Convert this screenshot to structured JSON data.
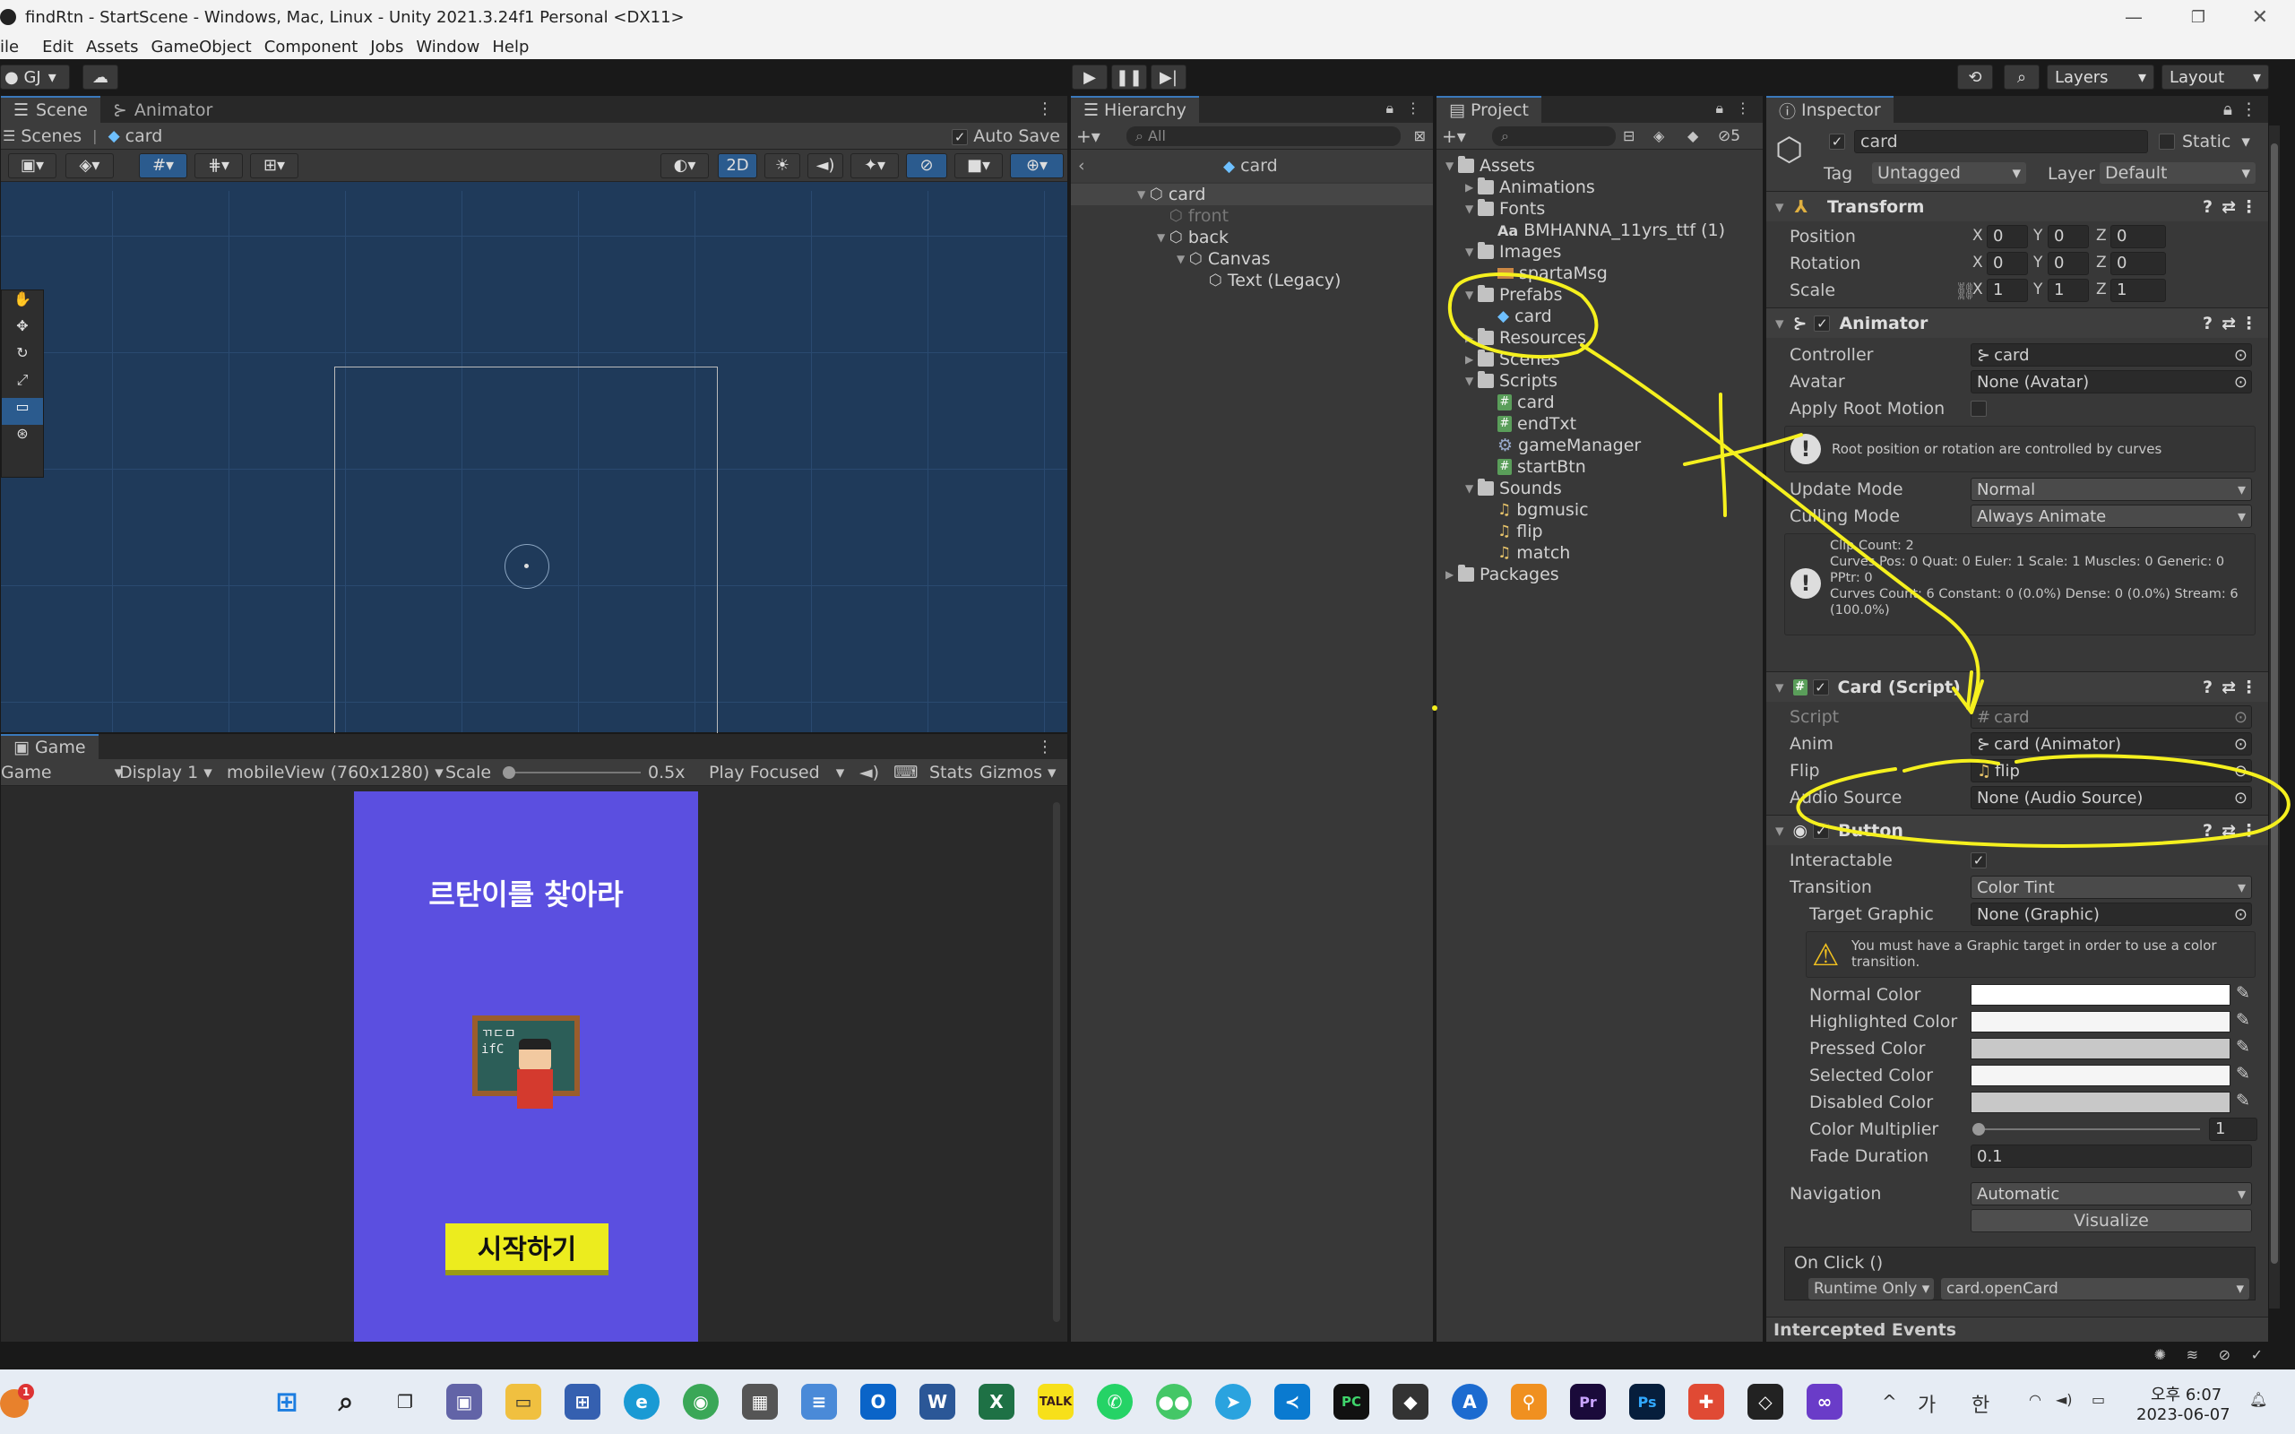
{
  "window": {
    "title": "findRtn - StartScene - Windows, Mac, Linux - Unity 2021.3.24f1 Personal <DX11>"
  },
  "menu": [
    "File",
    "Edit",
    "Assets",
    "GameObject",
    "Component",
    "Jobs",
    "Window",
    "Help"
  ],
  "toolbar": {
    "account": "GJ",
    "layers": "Layers",
    "layout": "Layout"
  },
  "scene": {
    "tabs": [
      "Scene",
      "Animator"
    ],
    "breadcrumb_root": "Scenes",
    "breadcrumb_item": "card",
    "auto_save": "Auto Save",
    "mode_2d": "2D"
  },
  "game": {
    "tab": "Game",
    "mode": "Game",
    "display": "Display 1",
    "resolution": "mobileView (760x1280)",
    "scale_label": "Scale",
    "scale_value": "0.5x",
    "play_focused": "Play Focused",
    "stats": "Stats",
    "gizmos": "Gizmos",
    "heading": "르탄이를 찾아라",
    "board_text": "ㄲㄷㅁ\nifC",
    "start_button": "시작하기",
    "bg_color": "#5b4fe0"
  },
  "hierarchy": {
    "tab": "Hierarchy",
    "search_placeholder": "All",
    "root": "card",
    "items": [
      {
        "label": "card",
        "depth": 0
      },
      {
        "label": "front",
        "depth": 1
      },
      {
        "label": "back",
        "depth": 1
      },
      {
        "label": "Canvas",
        "depth": 2
      },
      {
        "label": "Text (Legacy)",
        "depth": 3
      }
    ]
  },
  "project": {
    "tab": "Project",
    "count": "5",
    "items": [
      {
        "label": "Assets",
        "depth": 0,
        "kind": "folder"
      },
      {
        "label": "Animations",
        "depth": 1,
        "kind": "folder"
      },
      {
        "label": "Fonts",
        "depth": 1,
        "kind": "folder"
      },
      {
        "label": "BMHANNA_11yrs_ttf (1)",
        "depth": 2,
        "kind": "font"
      },
      {
        "label": "Images",
        "depth": 1,
        "kind": "folder"
      },
      {
        "label": "spartaMsg",
        "depth": 2,
        "kind": "image"
      },
      {
        "label": "Prefabs",
        "depth": 1,
        "kind": "folder"
      },
      {
        "label": "card",
        "depth": 2,
        "kind": "prefab"
      },
      {
        "label": "Resources",
        "depth": 1,
        "kind": "folder"
      },
      {
        "label": "Scenes",
        "depth": 1,
        "kind": "folder"
      },
      {
        "label": "Scripts",
        "depth": 1,
        "kind": "folder"
      },
      {
        "label": "card",
        "depth": 2,
        "kind": "script"
      },
      {
        "label": "endTxt",
        "depth": 2,
        "kind": "script"
      },
      {
        "label": "gameManager",
        "depth": 2,
        "kind": "gear"
      },
      {
        "label": "startBtn",
        "depth": 2,
        "kind": "script"
      },
      {
        "label": "Sounds",
        "depth": 1,
        "kind": "folder"
      },
      {
        "label": "bgmusic",
        "depth": 2,
        "kind": "audio"
      },
      {
        "label": "flip",
        "depth": 2,
        "kind": "audio"
      },
      {
        "label": "match",
        "depth": 2,
        "kind": "audio"
      },
      {
        "label": "Packages",
        "depth": 0,
        "kind": "folder"
      }
    ]
  },
  "inspector": {
    "tab": "Inspector",
    "name": "card",
    "static": "Static",
    "tag_label": "Tag",
    "tag": "Untagged",
    "layer_label": "Layer",
    "layer": "Default",
    "transform": {
      "title": "Transform",
      "position": {
        "label": "Position",
        "x": "0",
        "y": "0",
        "z": "0"
      },
      "rotation": {
        "label": "Rotation",
        "x": "0",
        "y": "0",
        "z": "0"
      },
      "scale": {
        "label": "Scale",
        "x": "1",
        "y": "1",
        "z": "1"
      }
    },
    "animator": {
      "title": "Animator",
      "controller_label": "Controller",
      "controller": "card",
      "avatar_label": "Avatar",
      "avatar": "None (Avatar)",
      "root_motion_label": "Apply Root Motion",
      "root_info": "Root position or rotation are controlled by curves",
      "update_label": "Update Mode",
      "update": "Normal",
      "culling_label": "Culling Mode",
      "culling": "Always Animate",
      "clip_info": "Clip Count: 2\nCurves Pos: 0 Quat: 0 Euler: 1 Scale: 1 Muscles: 0 Generic: 0 PPtr: 0\nCurves Count: 6 Constant: 0 (0.0%) Dense: 0 (0.0%) Stream: 6 (100.0%)"
    },
    "card_script": {
      "title": "Card (Script)",
      "script_label": "Script",
      "script": "card",
      "anim_label": "Anim",
      "anim": "card (Animator)",
      "flip_label": "Flip",
      "flip": "flip",
      "audio_label": "Audio Source",
      "audio": "None (Audio Source)"
    },
    "button": {
      "title": "Button",
      "interactable_label": "Interactable",
      "transition_label": "Transition",
      "transition": "Color Tint",
      "target_label": "Target Graphic",
      "target": "None (Graphic)",
      "warning": "You must have a Graphic target in order to use a color transition.",
      "normal": "Normal Color",
      "highlighted": "Highlighted Color",
      "pressed": "Pressed Color",
      "selected": "Selected Color",
      "disabled": "Disabled Color",
      "multiplier_label": "Color Multiplier",
      "multiplier": "1",
      "fade_label": "Fade Duration",
      "fade": "0.1",
      "nav_label": "Navigation",
      "nav": "Automatic",
      "visualize": "Visualize",
      "onclick": "On Click ()",
      "runtime": "Runtime Only",
      "func": "card.openCard"
    },
    "intercepted": "Intercepted Events"
  },
  "clock": {
    "time": "오후 6:07",
    "date": "2023-06-07"
  },
  "ime": {
    "a": "가",
    "b": "한"
  },
  "annotation_color": "#f5f01e"
}
